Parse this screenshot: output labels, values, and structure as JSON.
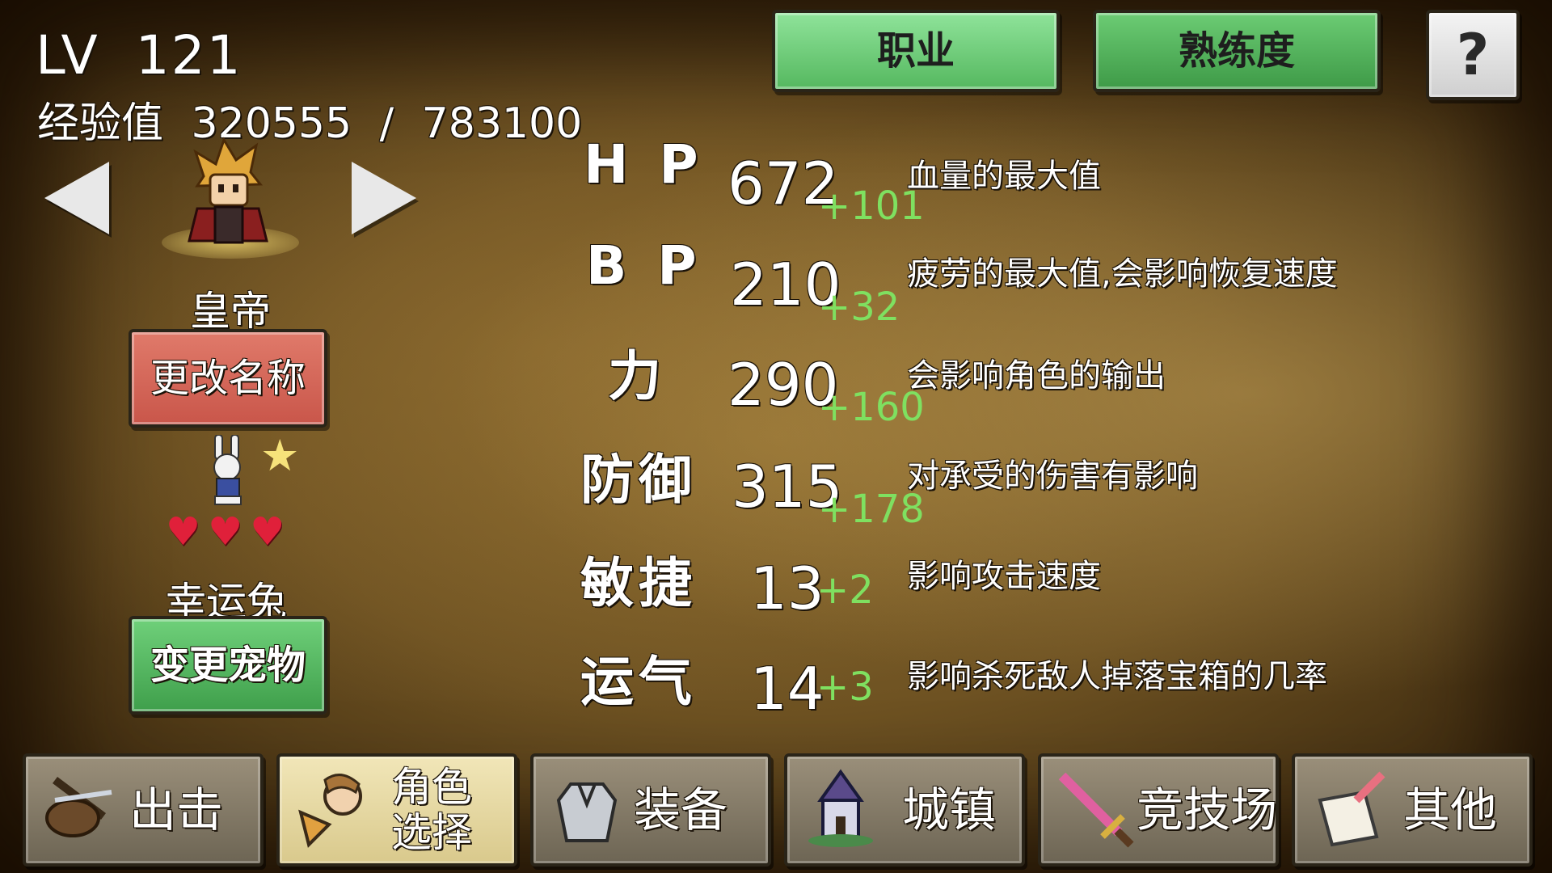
{
  "level": {
    "label": "LV",
    "value": "121"
  },
  "experience": {
    "label": "经验值",
    "current": "320555",
    "separator": "/",
    "max": "783100"
  },
  "character": {
    "class_name": "皇帝",
    "rename_button": "更改名称"
  },
  "pet": {
    "name": "幸运兔",
    "change_button": "变更宠物",
    "hearts": [
      "♥",
      "♥",
      "♥"
    ],
    "star": "★"
  },
  "top_buttons": {
    "job": "职业",
    "mastery": "熟练度",
    "help": "?"
  },
  "stats": [
    {
      "label": "HP",
      "value": "672",
      "bonus": "+101",
      "desc": "血量的最大值"
    },
    {
      "label": "BP",
      "value": "210",
      "bonus": "+32",
      "desc": "疲劳的最大值,会影响恢复速度"
    },
    {
      "label": "力",
      "value": "290",
      "bonus": "+160",
      "desc": "会影响角色的输出"
    },
    {
      "label": "防御",
      "value": "315",
      "bonus": "+178",
      "desc": "对承受的伤害有影响"
    },
    {
      "label": "敏捷",
      "value": "13",
      "bonus": "+2",
      "desc": "影响攻击速度"
    },
    {
      "label": "运气",
      "value": "14",
      "bonus": "+3",
      "desc": "影响杀死敌人掉落宝箱的几率"
    }
  ],
  "bottom_nav": [
    {
      "label": "出击",
      "icon": "shovel-icon"
    },
    {
      "label_line1": "角色",
      "label_line2": "选择",
      "icon": "character-select-icon"
    },
    {
      "label": "装备",
      "icon": "armor-icon"
    },
    {
      "label": "城镇",
      "icon": "town-icon"
    },
    {
      "label": "竞技场",
      "icon": "sword-icon"
    },
    {
      "label": "其他",
      "icon": "scroll-icon"
    }
  ]
}
